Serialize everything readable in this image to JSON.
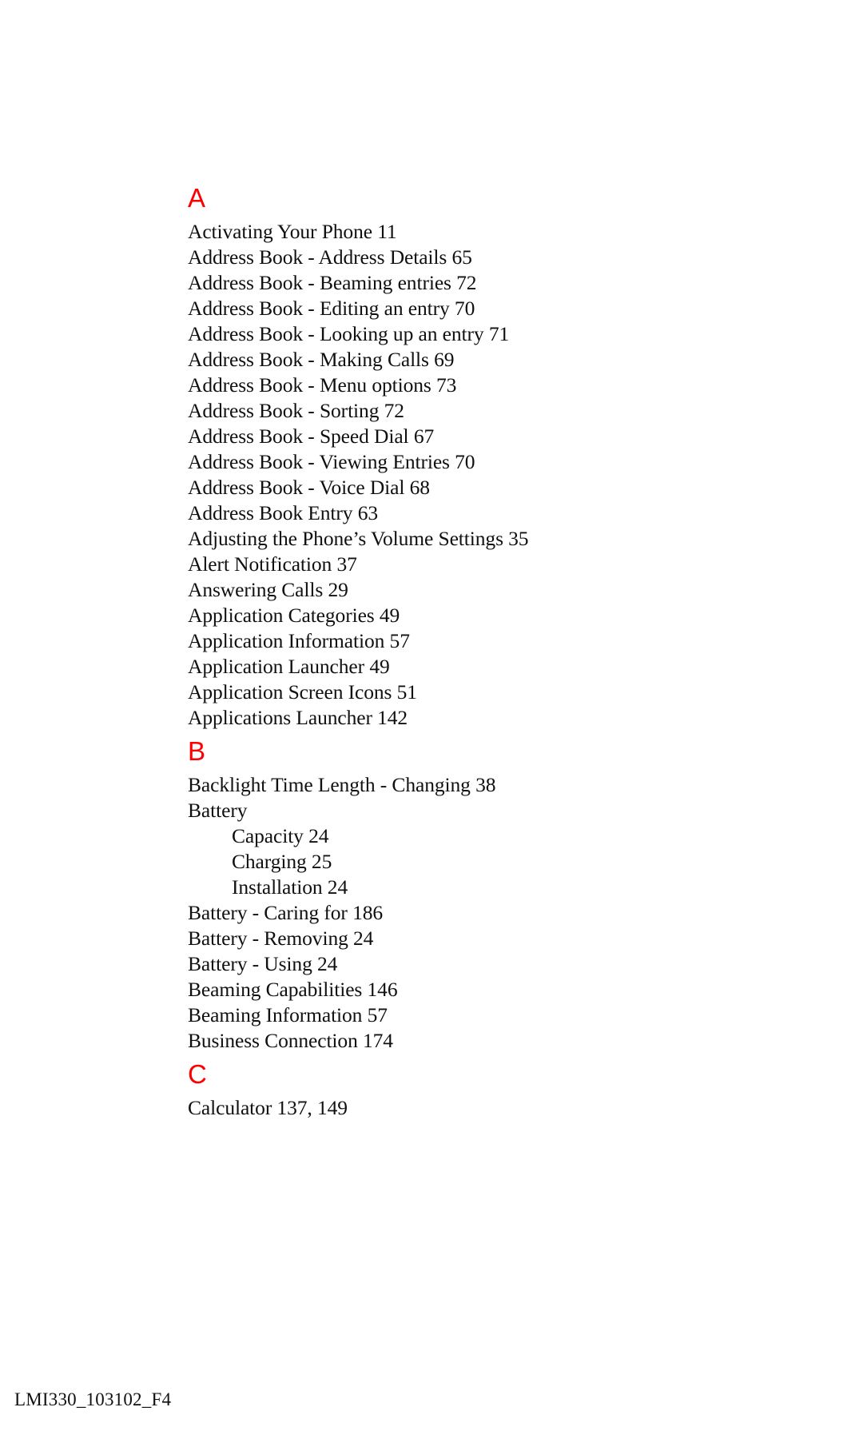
{
  "document": {
    "type": "index-page",
    "footer_id": "LMI330_103102_F4",
    "accent_color": "#fe0000",
    "text_color": "#101010",
    "background_color": "#ffffff"
  },
  "sections": [
    {
      "letter": "A",
      "entries": [
        {
          "text": "Activating Your Phone 11",
          "level": 1
        },
        {
          "text": "Address Book - Address Details 65",
          "level": 1
        },
        {
          "text": "Address Book - Beaming entries 72",
          "level": 1
        },
        {
          "text": "Address Book - Editing an entry 70",
          "level": 1
        },
        {
          "text": "Address Book - Looking up an entry 71",
          "level": 1
        },
        {
          "text": "Address Book - Making Calls 69",
          "level": 1
        },
        {
          "text": "Address Book - Menu options 73",
          "level": 1
        },
        {
          "text": "Address Book - Sorting 72",
          "level": 1
        },
        {
          "text": "Address Book - Speed Dial 67",
          "level": 1
        },
        {
          "text": "Address Book - Viewing Entries 70",
          "level": 1
        },
        {
          "text": "Address Book - Voice Dial 68",
          "level": 1
        },
        {
          "text": "Address Book Entry 63",
          "level": 1
        },
        {
          "text": "Adjusting the Phone’s Volume Settings 35",
          "level": 1
        },
        {
          "text": "Alert Notification 37",
          "level": 1
        },
        {
          "text": "Answering Calls 29",
          "level": 1
        },
        {
          "text": "Application Categories 49",
          "level": 1
        },
        {
          "text": "Application Information 57",
          "level": 1
        },
        {
          "text": "Application Launcher 49",
          "level": 1
        },
        {
          "text": "Application Screen Icons 51",
          "level": 1
        },
        {
          "text": "Applications Launcher 142",
          "level": 1
        }
      ]
    },
    {
      "letter": "B",
      "entries": [
        {
          "text": "Backlight Time Length - Changing 38",
          "level": 1
        },
        {
          "text": "Battery",
          "level": 1
        },
        {
          "text": "Capacity 24",
          "level": 2
        },
        {
          "text": "Charging 25",
          "level": 2
        },
        {
          "text": "Installation 24",
          "level": 2
        },
        {
          "text": "Battery - Caring for 186",
          "level": 1
        },
        {
          "text": "Battery - Removing 24",
          "level": 1
        },
        {
          "text": "Battery - Using 24",
          "level": 1
        },
        {
          "text": "Beaming Capabilities 146",
          "level": 1
        },
        {
          "text": "Beaming Information 57",
          "level": 1
        },
        {
          "text": "Business Connection 174",
          "level": 1
        }
      ]
    },
    {
      "letter": "C",
      "entries": [
        {
          "text": "Calculator 137, 149",
          "level": 1
        }
      ]
    }
  ]
}
